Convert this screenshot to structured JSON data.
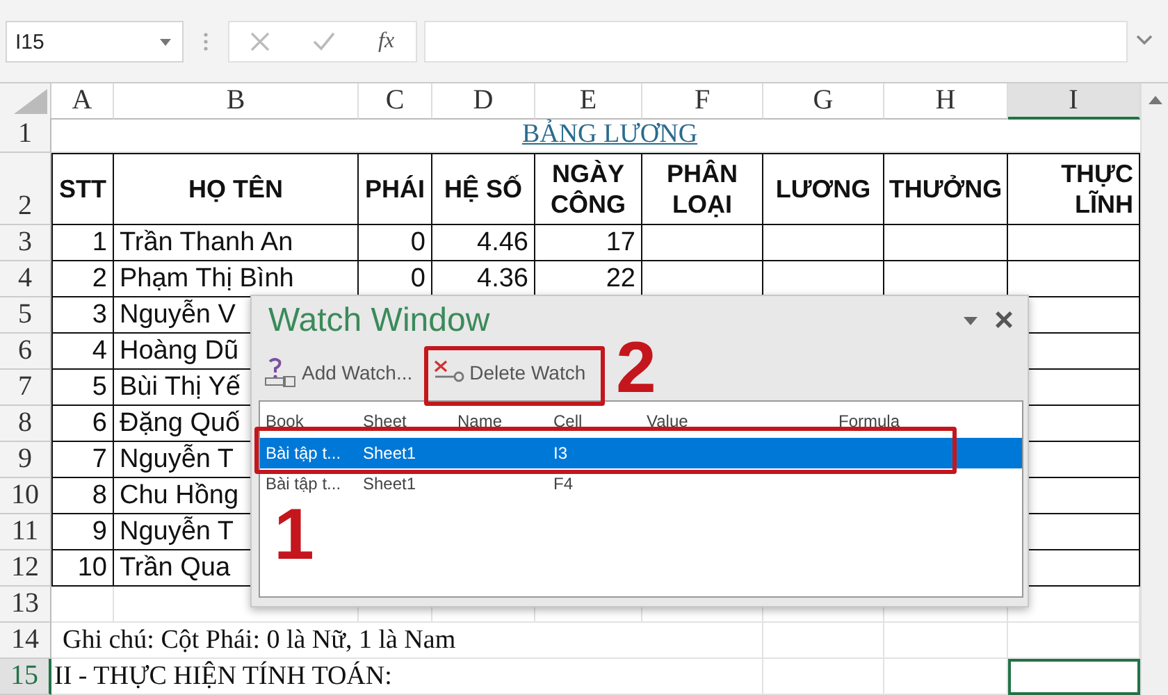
{
  "name_box": {
    "value": "I15"
  },
  "formula_bar": {
    "function_label": "fx"
  },
  "columns": [
    {
      "label": "A",
      "selected": false
    },
    {
      "label": "B",
      "selected": false
    },
    {
      "label": "C",
      "selected": false
    },
    {
      "label": "D",
      "selected": false
    },
    {
      "label": "E",
      "selected": false
    },
    {
      "label": "F",
      "selected": false
    },
    {
      "label": "G",
      "selected": false
    },
    {
      "label": "H",
      "selected": false
    },
    {
      "label": "I",
      "selected": true
    }
  ],
  "rows": [
    {
      "number": "1",
      "kind": "title",
      "selected": false,
      "title": "BẢNG LƯƠNG"
    },
    {
      "number": "2",
      "kind": "header",
      "selected": false,
      "cells": [
        "STT",
        "HỌ TÊN",
        "PHÁI",
        "HỆ SỐ",
        "NGÀY CÔNG",
        "PHÂN LOẠI",
        "LƯƠNG",
        "THƯỞNG",
        "THỰC LĨNH"
      ]
    },
    {
      "number": "3",
      "kind": "data",
      "selected": false,
      "cells": [
        "1",
        "Trần Thanh An",
        "0",
        "4.46",
        "17"
      ]
    },
    {
      "number": "4",
      "kind": "data",
      "selected": false,
      "cells": [
        "2",
        "Phạm Thị Bình",
        "0",
        "4.36",
        "22"
      ]
    },
    {
      "number": "5",
      "kind": "data",
      "selected": false,
      "cells": [
        "3",
        "Nguyễn V"
      ]
    },
    {
      "number": "6",
      "kind": "data",
      "selected": false,
      "cells": [
        "4",
        "Hoàng Dũ"
      ]
    },
    {
      "number": "7",
      "kind": "data",
      "selected": false,
      "cells": [
        "5",
        "Bùi Thị Yế"
      ]
    },
    {
      "number": "8",
      "kind": "data",
      "selected": false,
      "cells": [
        "6",
        "Đặng Quố"
      ]
    },
    {
      "number": "9",
      "kind": "data",
      "selected": false,
      "cells": [
        "7",
        "Nguyễn T"
      ]
    },
    {
      "number": "10",
      "kind": "data",
      "selected": false,
      "cells": [
        "8",
        "Chu Hồng"
      ]
    },
    {
      "number": "11",
      "kind": "data",
      "selected": false,
      "cells": [
        "9",
        "Nguyễn T"
      ]
    },
    {
      "number": "12",
      "kind": "data",
      "selected": false,
      "cells": [
        "10",
        "Trần Qua"
      ]
    },
    {
      "number": "13",
      "kind": "blank",
      "selected": false
    },
    {
      "number": "14",
      "kind": "note",
      "selected": false,
      "text": "Ghi chú: Cột Phái: 0 là Nữ, 1 là Nam"
    },
    {
      "number": "15",
      "kind": "note",
      "selected": true,
      "text": "II - THỰC HIỆN TÍNH TOÁN:"
    }
  ],
  "watch_window": {
    "title": "Watch Window",
    "close": "×",
    "toolbar": [
      {
        "label": "Add Watch..."
      },
      {
        "label": "Delete Watch"
      }
    ],
    "columns": [
      "Book",
      "Sheet",
      "Name",
      "Cell",
      "Value",
      "Formula"
    ],
    "rows": [
      {
        "book": "Bài tập t...",
        "sheet": "Sheet1",
        "cell": "I3",
        "selected": true
      },
      {
        "book": "Bài tập t...",
        "sheet": "Sheet1",
        "cell": "F4",
        "selected": false
      }
    ]
  },
  "annotations": [
    {
      "number": "1"
    },
    {
      "number": "2"
    }
  ]
}
